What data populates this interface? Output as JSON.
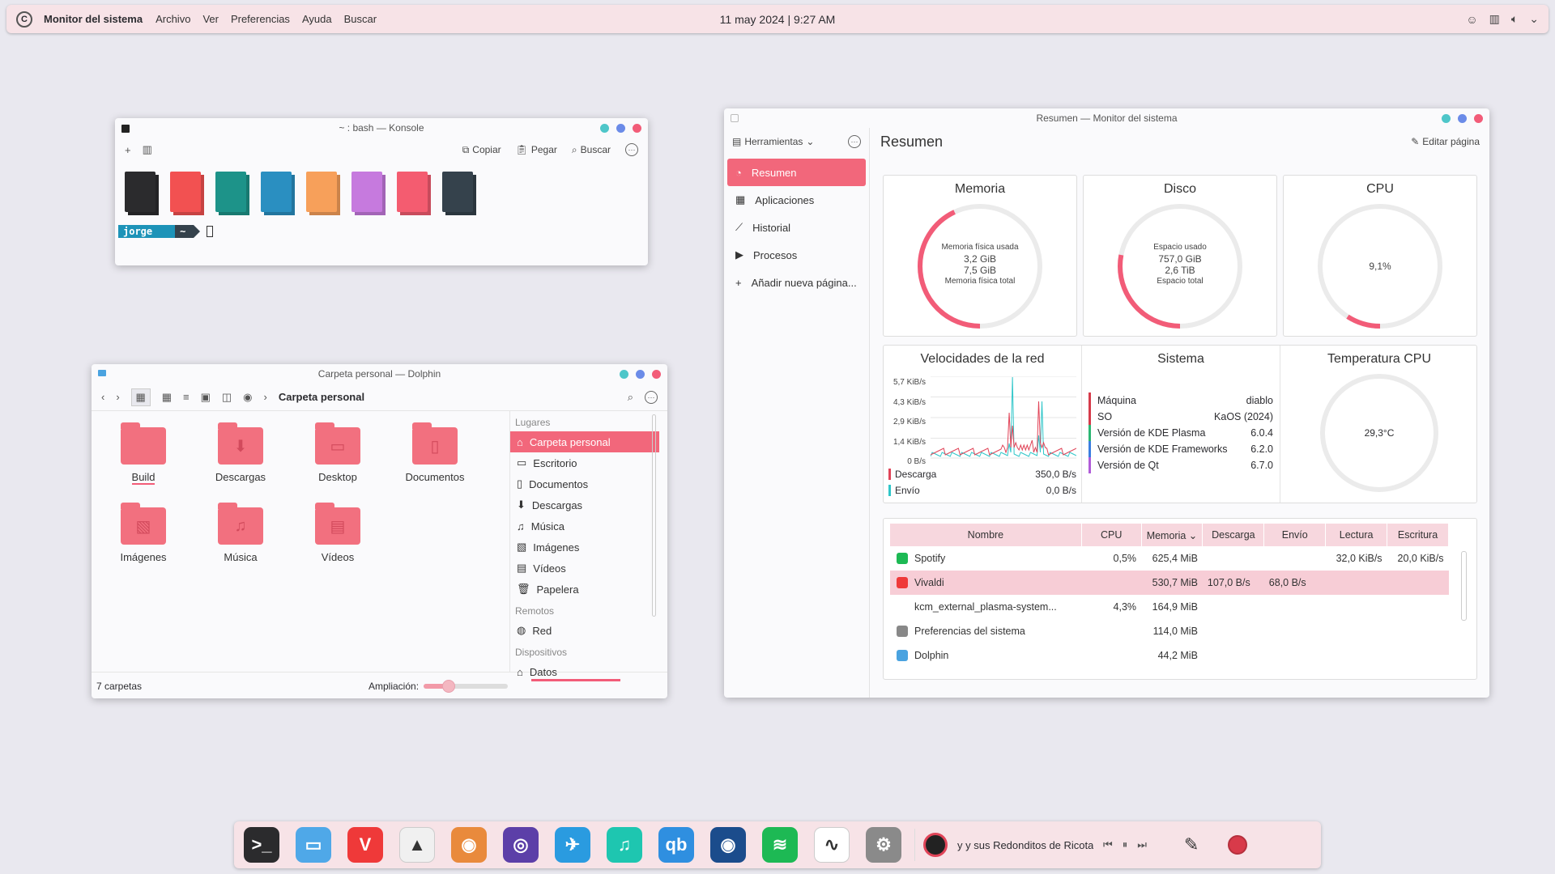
{
  "topbar": {
    "app_name": "Monitor del sistema",
    "menus": [
      "Archivo",
      "Ver",
      "Preferencias",
      "Ayuda",
      "Buscar"
    ],
    "clock": "11 may 2024 | 9:27 AM"
  },
  "konsole": {
    "title": "~ : bash — Konsole",
    "copy": "Copiar",
    "paste": "Pegar",
    "search": "Buscar",
    "swatches": [
      "#2b2b2d",
      "#f25151",
      "#1d9389",
      "#2a8fc1",
      "#f7a05a",
      "#c67ade",
      "#f45c70",
      "#35424c"
    ],
    "prompt_user": "jorge",
    "prompt_dir": "~"
  },
  "dolphin": {
    "title": "Carpeta personal — Dolphin",
    "breadcrumb": "Carpeta personal",
    "folders": [
      "Build",
      "Descargas",
      "Desktop",
      "Documentos",
      "Imágenes",
      "Música",
      "Vídeos"
    ],
    "places_header": "Lugares",
    "places": [
      "Carpeta personal",
      "Escritorio",
      "Documentos",
      "Descargas",
      "Música",
      "Imágenes",
      "Vídeos",
      "Papelera"
    ],
    "remote_header": "Remotos",
    "remote": [
      "Red"
    ],
    "devices_header": "Dispositivos",
    "devices": [
      "Datos"
    ],
    "status": "7 carpetas",
    "zoom_label": "Ampliación:",
    "zoom_level": 0.3
  },
  "sysmon": {
    "title": "Resumen — Monitor del sistema",
    "tools": "Herramientas",
    "page_title": "Resumen",
    "edit_page": "Editar página",
    "nav": [
      "Resumen",
      "Aplicaciones",
      "Historial",
      "Procesos",
      "Añadir nueva página..."
    ],
    "memory": {
      "title": "Memoria",
      "label_used": "Memoria física usada",
      "used": "3,2 GiB",
      "total": "7,5 GiB",
      "label_total": "Memoria física total",
      "fraction": 0.43
    },
    "disk": {
      "title": "Disco",
      "label_used": "Espacio usado",
      "used": "757,0 GiB",
      "total": "2,6 TiB",
      "label_total": "Espacio total",
      "fraction": 0.28
    },
    "cpu": {
      "title": "CPU",
      "value": "9,1%",
      "fraction": 0.091
    },
    "network": {
      "title": "Velocidades de la red",
      "ticks": [
        "5,7 KiB/s",
        "4,3 KiB/s",
        "2,9 KiB/s",
        "1,4 KiB/s",
        "0 B/s"
      ],
      "download_label": "Descarga",
      "download_value": "350,0 B/s",
      "upload_label": "Envío",
      "upload_value": "0,0 B/s",
      "download_color": "#e04458",
      "upload_color": "#2fc6c9"
    },
    "system": {
      "title": "Sistema",
      "rows": [
        {
          "k": "Máquina",
          "v": "diablo",
          "c": "#d63b4a"
        },
        {
          "k": "SO",
          "v": "KaOS (2024)",
          "c": "#d63b4a"
        },
        {
          "k": "Versión de KDE Plasma",
          "v": "6.0.4",
          "c": "#2bb673"
        },
        {
          "k": "Versión de KDE Frameworks",
          "v": "6.2.0",
          "c": "#3a7ee0"
        },
        {
          "k": "Versión de Qt",
          "v": "6.7.0",
          "c": "#b05cd8"
        }
      ]
    },
    "temp": {
      "title": "Temperatura CPU",
      "value": "29,3°C"
    },
    "table": {
      "headers": [
        "Nombre",
        "CPU",
        "Memoria",
        "Descarga",
        "Envío",
        "Lectura",
        "Escritura"
      ],
      "rows": [
        {
          "name": "Spotify",
          "cpu": "0,5%",
          "mem": "625,4 MiB",
          "down": "",
          "up": "",
          "read": "32,0 KiB/s",
          "write": "20,0 KiB/s",
          "icon": "#1db954"
        },
        {
          "name": "Vivaldi",
          "cpu": "",
          "mem": "530,7 MiB",
          "down": "107,0 B/s",
          "up": "68,0 B/s",
          "read": "",
          "write": "",
          "icon": "#ef3939"
        },
        {
          "name": "kcm_external_plasma-system...",
          "cpu": "4,3%",
          "mem": "164,9 MiB",
          "down": "",
          "up": "",
          "read": "",
          "write": "",
          "icon": ""
        },
        {
          "name": "Preferencias del sistema",
          "cpu": "",
          "mem": "114,0 MiB",
          "down": "",
          "up": "",
          "read": "",
          "write": "",
          "icon": "#888888"
        },
        {
          "name": "Dolphin",
          "cpu": "",
          "mem": "44,2 MiB",
          "down": "",
          "up": "",
          "read": "",
          "write": "",
          "icon": "#4aa3e0"
        }
      ]
    }
  },
  "dock": {
    "apps": [
      {
        "name": "terminal-icon",
        "color": "#2b2b2d",
        "glyph": ">_"
      },
      {
        "name": "files-icon",
        "color": "#4fa8e8",
        "glyph": "▭"
      },
      {
        "name": "vivaldi-icon",
        "color": "#ef3939",
        "glyph": "V"
      },
      {
        "name": "inkscape-icon",
        "color": "#f0f0f0",
        "glyph": "▲"
      },
      {
        "name": "gimp-icon",
        "color": "#e98a3c",
        "glyph": "◉"
      },
      {
        "name": "podcast-icon",
        "color": "#5c3fa8",
        "glyph": "◎"
      },
      {
        "name": "swift-icon",
        "color": "#2a9be0",
        "glyph": "✈"
      },
      {
        "name": "music-icon",
        "color": "#1ec6b0",
        "glyph": "♫"
      },
      {
        "name": "qbittorrent-icon",
        "color": "#2f8fe0",
        "glyph": "qb"
      },
      {
        "name": "steam-icon",
        "color": "#1b4c8c",
        "glyph": "◉"
      },
      {
        "name": "spotify-icon",
        "color": "#1db954",
        "glyph": "≋"
      },
      {
        "name": "system-monitor-icon",
        "color": "#ffffff",
        "glyph": "∿"
      },
      {
        "name": "settings-icon",
        "color": "#8a8a8a",
        "glyph": "⚙"
      }
    ],
    "now_playing": "y y sus Redonditos de Ricota - El Pil"
  }
}
